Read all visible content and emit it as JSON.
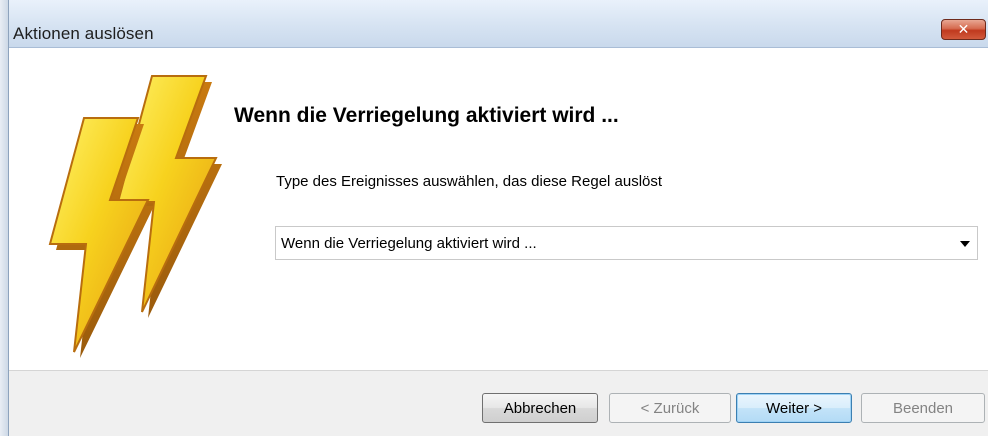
{
  "window": {
    "title": "Aktionen auslösen",
    "close_label": "✕"
  },
  "main": {
    "heading": "Wenn die Verriegelung aktiviert wird ...",
    "instruction": "Type des Ereignisses auswählen, das diese Regel auslöst",
    "event_select": {
      "value": "Wenn die Verriegelung aktiviert wird ..."
    }
  },
  "footer": {
    "cancel_label": "Abbrechen",
    "back_label": "< Zurück",
    "next_label": "Weiter >",
    "finish_label": "Beenden"
  },
  "icons": {
    "illustration": "lightning-bolts-icon",
    "close": "close-icon",
    "dropdown": "chevron-down-icon"
  },
  "colors": {
    "bolt_yellow": "#f7d21e",
    "bolt_orange": "#e59a12",
    "close_red": "#c0391e",
    "default_button_border": "#3c7fb1"
  }
}
